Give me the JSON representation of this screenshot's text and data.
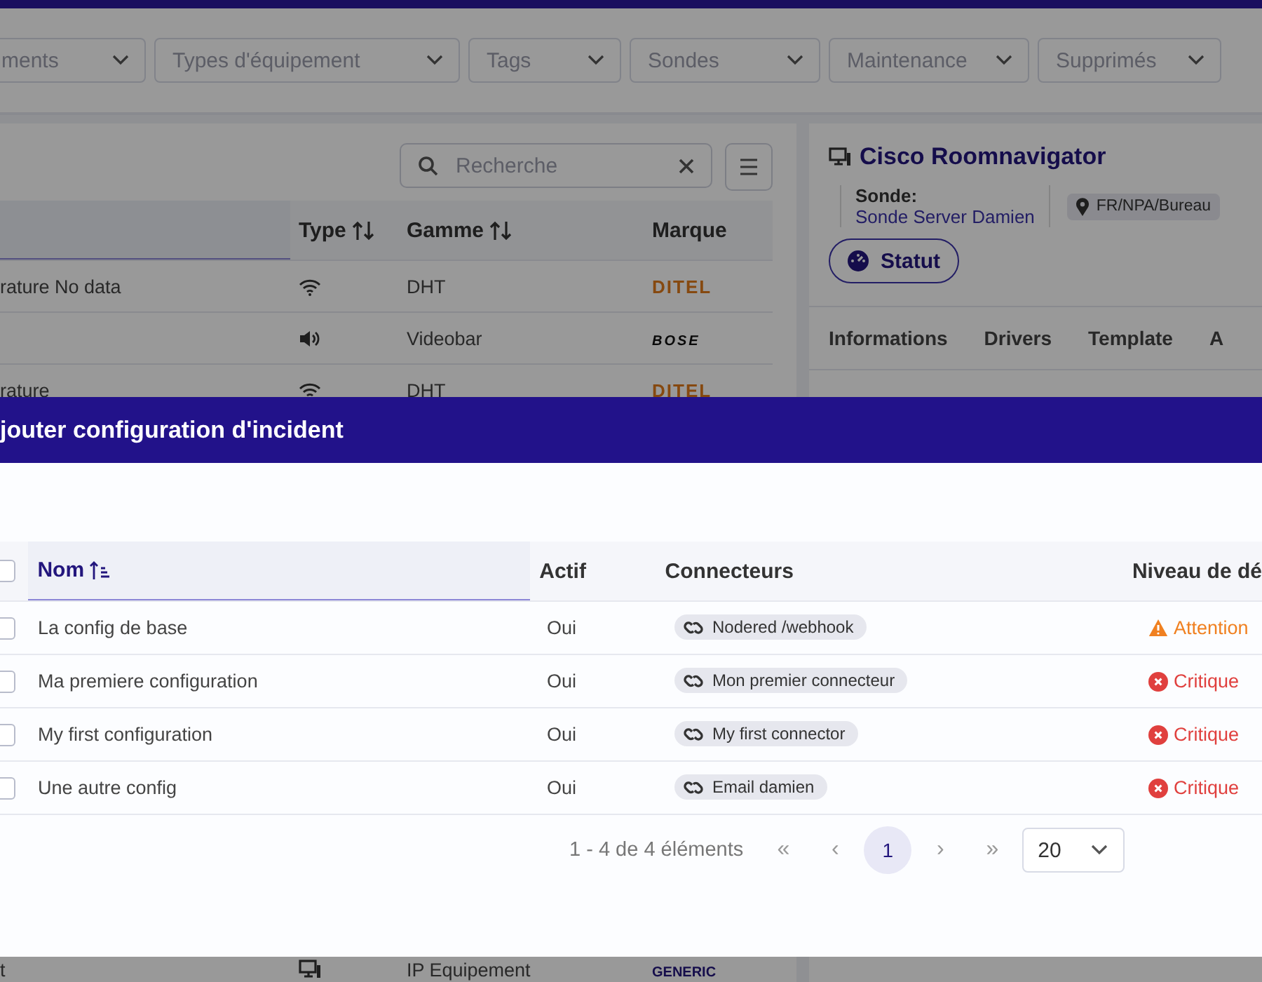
{
  "filters": [
    {
      "label": "ments"
    },
    {
      "label": "Types d'équipement"
    },
    {
      "label": "Tags"
    },
    {
      "label": "Sondes"
    },
    {
      "label": "Maintenance"
    },
    {
      "label": "Supprimés"
    }
  ],
  "search": {
    "placeholder": "Recherche"
  },
  "equipment_table": {
    "columns": [
      {
        "label": "Type",
        "sortable": true
      },
      {
        "label": "Gamme",
        "sortable": true
      },
      {
        "label": "Marque",
        "sortable": false
      }
    ],
    "rows": [
      {
        "name": "rature No data",
        "kind": "wifi",
        "range": "DHT",
        "brand": {
          "label": "DITEL",
          "kind": "ditel"
        }
      },
      {
        "kind": "speaker",
        "range": "Videobar",
        "brand": {
          "label": "BOSE",
          "kind": "bose"
        }
      },
      {
        "name": "rature",
        "kind": "wifi",
        "range": "DHT",
        "brand": {
          "label": "DITEL",
          "kind": "ditel"
        }
      }
    ],
    "bottom_row": {
      "name": "t",
      "kind": "monitor",
      "range": "IP Equipement",
      "brand": {
        "label": "GENERIC",
        "kind": "generic"
      }
    }
  },
  "device": {
    "title": "Cisco Roomnavigator",
    "probe_label": "Sonde:",
    "probe": "Sonde Server Damien",
    "location": "FR/NPA/Bureau",
    "status_button": "Statut",
    "tabs": [
      {
        "label": "Informations"
      },
      {
        "label": "Drivers"
      },
      {
        "label": "Template"
      },
      {
        "label": "A"
      }
    ]
  },
  "modal": {
    "title": "jouter configuration d'incident",
    "header_checkbox": {
      "checked": false
    },
    "columns": [
      {
        "label": "Nom",
        "sorted": true
      },
      {
        "label": "Actif",
        "sorted": false
      },
      {
        "label": "Connecteurs",
        "sorted": false
      },
      {
        "label": "Niveau de dé",
        "sorted": false
      }
    ],
    "rows": [
      {
        "checked": false,
        "name": "La config de base",
        "active": "Oui",
        "connector": "Nodered /webhook",
        "level": "Attention",
        "kind": "warning"
      },
      {
        "checked": false,
        "name": "Ma premiere configuration",
        "active": "Oui",
        "connector": "Mon premier connecteur",
        "level": "Critique",
        "kind": "critical"
      },
      {
        "checked": false,
        "name": "My first configuration",
        "active": "Oui",
        "connector": "My first connector",
        "level": "Critique",
        "kind": "critical"
      },
      {
        "checked": false,
        "name": "Une autre config",
        "active": "Oui",
        "connector": "Email damien",
        "level": "Critique",
        "kind": "critical"
      }
    ],
    "pagination": {
      "summary": "1 - 4 de 4 éléments",
      "first": "«",
      "prev": "‹",
      "pages": [
        {
          "label": "1",
          "selected": true
        }
      ],
      "next": "›",
      "last": "»",
      "page_size": "20"
    }
  }
}
